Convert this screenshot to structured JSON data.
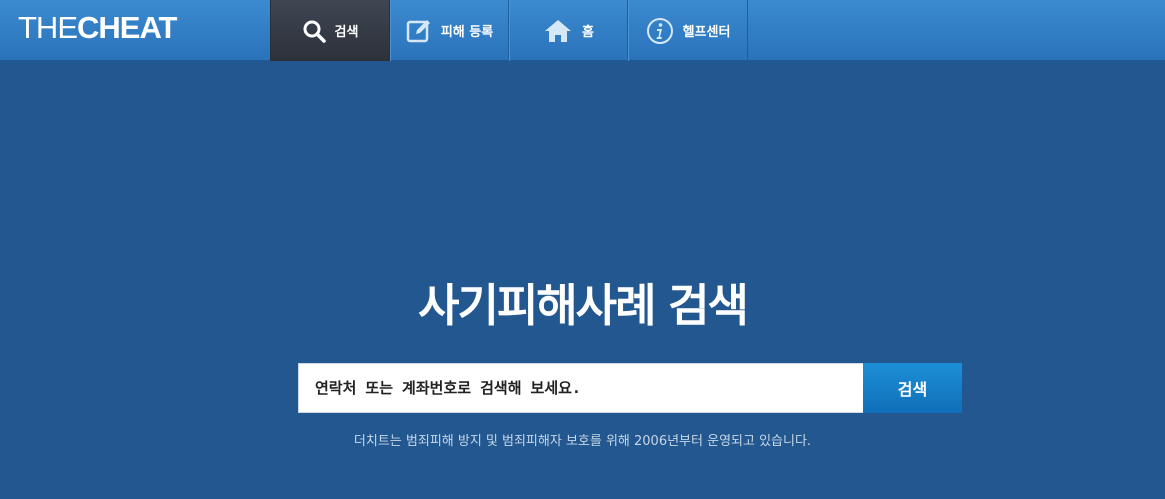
{
  "logo": {
    "part1": "THE",
    "part2": "CHEAT"
  },
  "nav": [
    {
      "label": "검색",
      "icon": "search-icon",
      "active": true
    },
    {
      "label": "피해 등록",
      "icon": "edit-icon",
      "active": false
    },
    {
      "label": "홈",
      "icon": "home-icon",
      "active": false
    },
    {
      "label": "헬프센터",
      "icon": "info-icon",
      "active": false
    }
  ],
  "hero": {
    "title": "사기피해사례 검색",
    "search_placeholder": "연락처 또는 계좌번호로 검색해 보세요.",
    "search_button": "검색",
    "subtext": "더치트는 범죄피해 방지 및 범죄피해자 보호를 위해 2006년부터 운영되고 있습니다."
  },
  "colors": {
    "background": "#23578f",
    "topbar": "#2a73bb",
    "nav_active": "#2c313a",
    "button": "#0f6fb8"
  }
}
